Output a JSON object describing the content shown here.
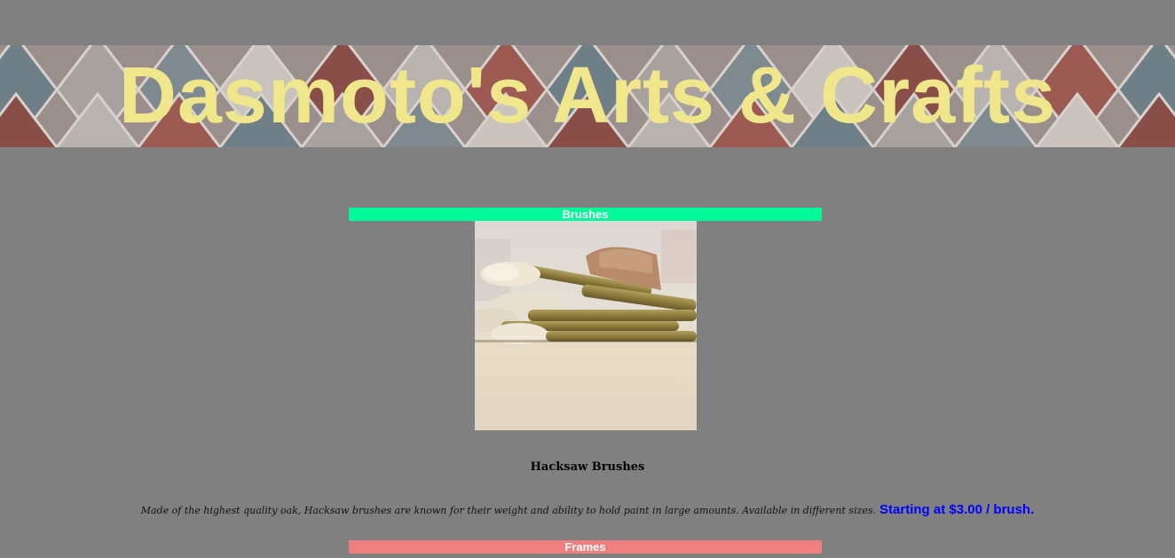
{
  "header": {
    "title": "Dasmoto's Arts & Crafts",
    "title_color": "#f0e68c"
  },
  "sections": [
    {
      "heading": "Brushes",
      "heading_bg": "#00fa9a",
      "image": "paint-brushes-photo",
      "product_name": "Hacksaw Brushes",
      "description": "Made of the highest quality oak, Hacksaw brushes are known for their weight and ability to hold paint in large amounts. Available in different sizes.",
      "price": "Starting at $3.00 / brush.",
      "price_color": "#0000ff"
    },
    {
      "heading": "Frames",
      "heading_bg": "#f08080",
      "image": "frames-photo"
    }
  ],
  "page_background": "#808080"
}
